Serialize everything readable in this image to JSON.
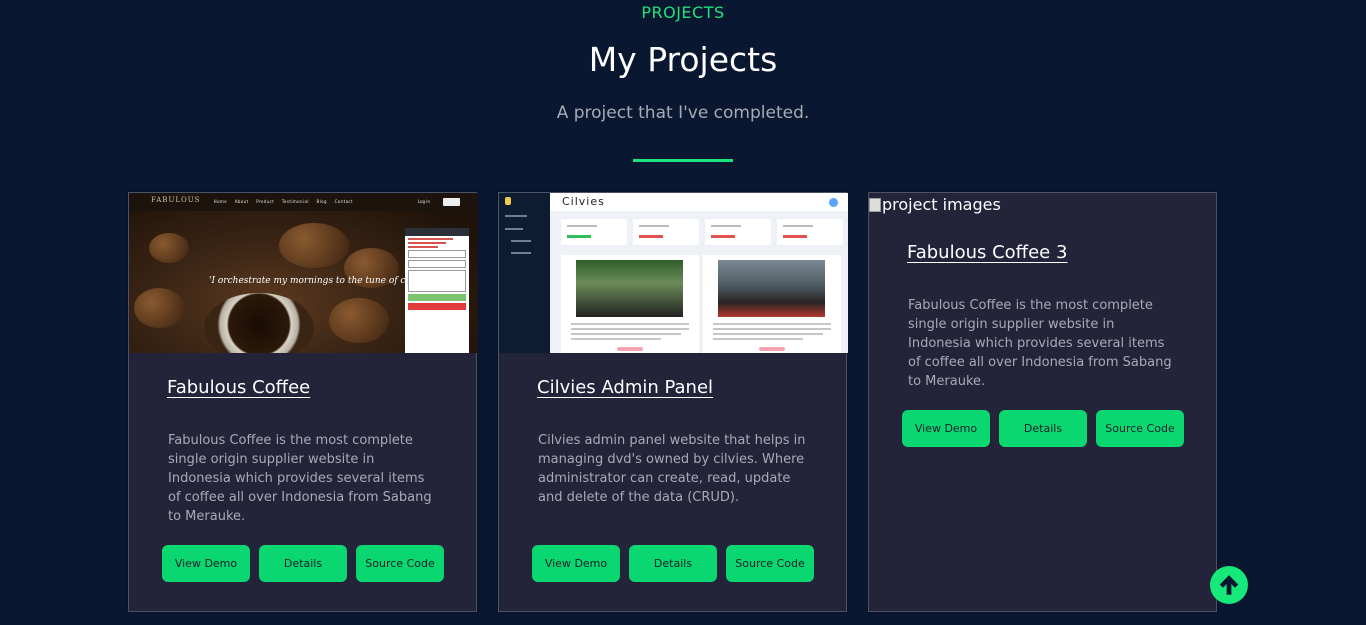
{
  "header": {
    "eyebrow": "PROJECTS",
    "title": "My Projects",
    "subtitle": "A project that I've completed."
  },
  "thumbnails": {
    "fabulous": {
      "logo": "FABULOUS",
      "nav": "Home About Product Testimonial Blog Contact",
      "login": "Log In",
      "quote": "'I orchestrate my mornings to the tune of coffee'"
    },
    "cilvies": {
      "brand": "Cilvies"
    }
  },
  "projects": [
    {
      "title": "Fabulous Coffee",
      "description": "Fabulous Coffee is the most complete single origin supplier website in Indonesia which provides several items of coffee all over Indonesia from Sabang to Merauke.",
      "buttons": {
        "demo": "View Demo",
        "details": "Details",
        "source": "Source Code"
      }
    },
    {
      "title": "Cilvies Admin Panel",
      "description": "Cilvies admin panel website that helps in managing dvd's owned by cilvies. Where administrator can create, read, update and delete of the data (CRUD).",
      "buttons": {
        "demo": "View Demo",
        "details": "Details",
        "source": "Source Code"
      }
    },
    {
      "title": "Fabulous Coffee 3",
      "image_alt": "project images",
      "description": "Fabulous Coffee is the most complete single origin supplier website in Indonesia which provides several items of coffee all over Indonesia from Sabang to Merauke.",
      "buttons": {
        "demo": "View Demo",
        "details": "Details",
        "source": "Source Code"
      }
    }
  ],
  "icons": {
    "scroll_top": "arrow-up-circle-icon",
    "broken_image": "broken-image-icon"
  },
  "colors": {
    "background": "#0a1730",
    "card": "#23243a",
    "accent": "#1de37d",
    "button": "#0bd770"
  }
}
